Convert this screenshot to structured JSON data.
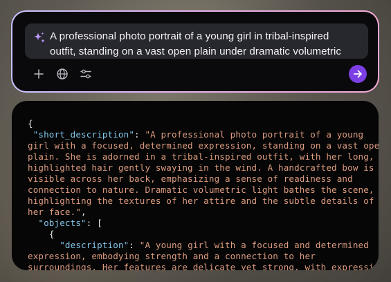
{
  "prompt": {
    "lines": [
      "A professional photo portrait of a young girl in tribal-inspired",
      "outfit, standing on a vast open plain under dramatic volumetric"
    ],
    "icon": "sparkle-icon"
  },
  "toolbar": {
    "add_icon": "plus-icon",
    "web_icon": "globe-icon",
    "settings_icon": "sliders-icon",
    "send_icon": "arrow-right-icon",
    "accent_color": "#7b3fe4"
  },
  "output": {
    "open_brace": "{",
    "short_description_key": "\"short_description\"",
    "short_description_lines": [
      "\"A professional photo portrait of a young",
      "girl with a focused, determined expression, standing on a vast open",
      "plain. She is adorned in a tribal-inspired outfit, with her long,",
      "highlighted hair gently swaying in the wind. A handcrafted bow is",
      "visible across her back, emphasizing a sense of readiness and",
      "connection to nature. Dramatic volumetric light bathes the scene,",
      "highlighting the textures of her attire and the subtle details of",
      "her face.\""
    ],
    "objects_key": "\"objects\"",
    "objects_open": "[",
    "object_open": "{",
    "description_key": "\"description\"",
    "description_lines": [
      "\"A young girl with a focused and determined",
      "expression, embodying strength and a connection to her",
      "surroundings. Her features are delicate yet strong, with expressive"
    ],
    "key_color": "#84c7e9",
    "string_color": "#dd9c7e"
  }
}
